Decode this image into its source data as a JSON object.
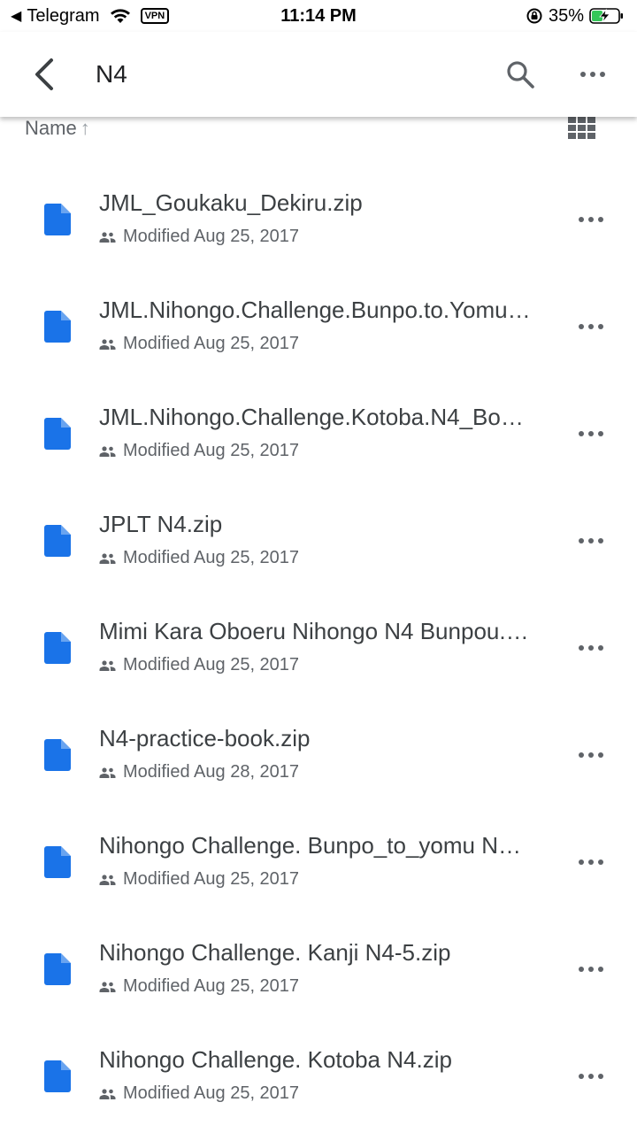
{
  "status_bar": {
    "back_app": "Telegram",
    "vpn": "VPN",
    "time": "11:14 PM",
    "battery_pct": "35%"
  },
  "app_bar": {
    "title": "N4"
  },
  "sort": {
    "label": "Name",
    "direction_glyph": "↑"
  },
  "files": [
    {
      "name": "JML_Goukaku_Dekiru.zip",
      "modified": "Modified Aug 25, 2017"
    },
    {
      "name": "JML.Nihongo.Challenge.Bunpo.to.Yomu…",
      "modified": "Modified Aug 25, 2017"
    },
    {
      "name": "JML.Nihongo.Challenge.Kotoba.N4_Bo…",
      "modified": "Modified Aug 25, 2017"
    },
    {
      "name": "JPLT N4.zip",
      "modified": "Modified Aug 25, 2017"
    },
    {
      "name": "Mimi Kara Oboeru Nihongo N4 Bunpou.…",
      "modified": "Modified Aug 25, 2017"
    },
    {
      "name": "N4-practice-book.zip",
      "modified": "Modified Aug 28, 2017"
    },
    {
      "name": "Nihongo Challenge. Bunpo_to_yomu N…",
      "modified": "Modified Aug 25, 2017"
    },
    {
      "name": "Nihongo Challenge. Kanji N4-5.zip",
      "modified": "Modified Aug 25, 2017"
    },
    {
      "name": "Nihongo Challenge. Kotoba N4.zip",
      "modified": "Modified Aug 25, 2017"
    }
  ],
  "colors": {
    "file_icon": "#1a73e8",
    "battery_charge": "#34c759"
  }
}
